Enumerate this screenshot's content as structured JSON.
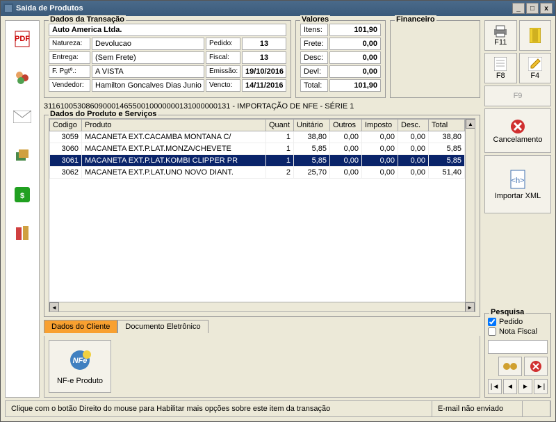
{
  "window": {
    "title": "Saida de Produtos"
  },
  "transacao": {
    "legend": "Dados da Transação",
    "company": "Auto America Ltda.",
    "natureza_lbl": "Natureza:",
    "natureza": "Devolucao",
    "entrega_lbl": "Entrega:",
    "entrega": "(Sem Frete)",
    "fpgto_lbl": "F. Pgtº.:",
    "fpgto": "A VISTA",
    "vendedor_lbl": "Vendedor:",
    "vendedor": "Hamilton Goncalves Dias Junio",
    "pedido_lbl": "Pedido:",
    "pedido": "13",
    "fiscal_lbl": "Fiscal:",
    "fiscal": "13",
    "emissao_lbl": "Emissão:",
    "emissao": "19/10/2016",
    "vencto_lbl": "Vencto:",
    "vencto": "14/11/2016"
  },
  "valores": {
    "legend": "Valores",
    "itens_lbl": "Itens:",
    "itens": "101,90",
    "frete_lbl": "Frete:",
    "frete": "0,00",
    "desc_lbl": "Desc:",
    "desc": "0,00",
    "devl_lbl": "Devl:",
    "devl": "0,00",
    "total_lbl": "Total:",
    "total": "101,90"
  },
  "financeiro": {
    "legend": "Financeiro"
  },
  "nfe_line": "31161005308609000146550010000000131000000131 - IMPORTAÇÃO DE NFE - SÉRIE 1",
  "produtos": {
    "legend": "Dados do Produto e Serviços",
    "headers": {
      "codigo": "Codigo",
      "produto": "Produto",
      "quant": "Quant",
      "unitario": "Unitário",
      "outros": "Outros",
      "imposto": "Imposto",
      "desc": "Desc.",
      "total": "Total"
    },
    "rows": [
      {
        "codigo": "3059",
        "produto": "MACANETA EXT.CACAMBA MONTANA C/",
        "quant": "1",
        "unitario": "38,80",
        "outros": "0,00",
        "imposto": "0,00",
        "desc": "0,00",
        "total": "38,80"
      },
      {
        "codigo": "3060",
        "produto": "MACANETA EXT.P.LAT.MONZA/CHEVETE",
        "quant": "1",
        "unitario": "5,85",
        "outros": "0,00",
        "imposto": "0,00",
        "desc": "0,00",
        "total": "5,85"
      },
      {
        "codigo": "3061",
        "produto": "MACANETA EXT.P.LAT.KOMBI CLIPPER PR",
        "quant": "1",
        "unitario": "5,85",
        "outros": "0,00",
        "imposto": "0,00",
        "desc": "0,00",
        "total": "5,85",
        "selected": true
      },
      {
        "codigo": "3062",
        "produto": "MACANETA EXT.P.LAT.UNO NOVO DIANT.",
        "quant": "2",
        "unitario": "25,70",
        "outros": "0,00",
        "imposto": "0,00",
        "desc": "0,00",
        "total": "51,40"
      }
    ]
  },
  "tabs": {
    "cliente": "Dados do Cliente",
    "eletronico": "Documento Eletrônico"
  },
  "bottom": {
    "nfe": "NF-e Produto"
  },
  "right": {
    "f11": "F11",
    "f8": "F8",
    "f4": "F4",
    "f9": "F9",
    "cancel": "Cancelamento",
    "import": "Importar XML"
  },
  "pesquisa": {
    "legend": "Pesquisa",
    "pedido": "Pedido",
    "nota": "Nota Fiscal"
  },
  "status": {
    "hint": "Clique com o botão Direito do mouse para Habilitar mais opções sobre este item da transação",
    "email": "E-mail não enviado"
  }
}
